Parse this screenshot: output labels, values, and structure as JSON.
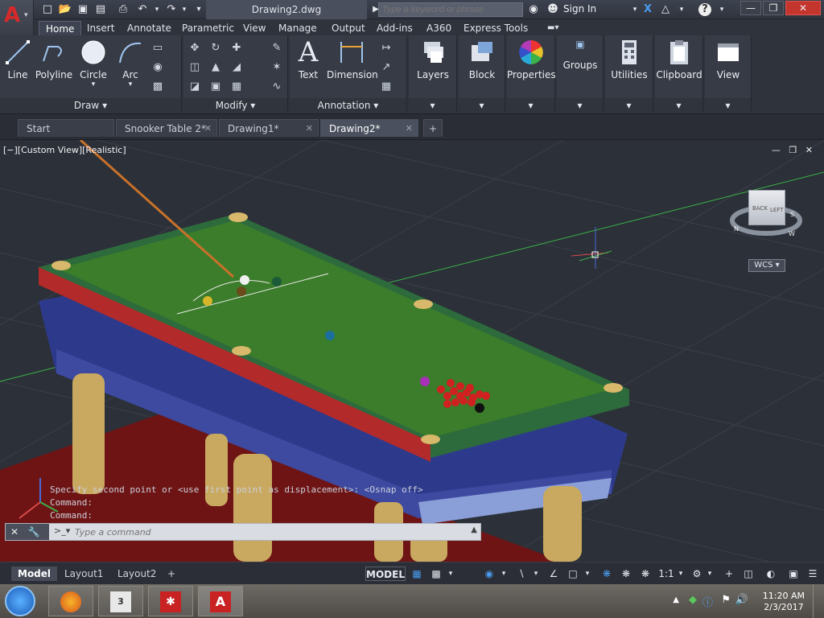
{
  "titlebar": {
    "doc_title": "Drawing2.dwg",
    "search_placeholder": "Type a keyword or phrase",
    "signin_label": "Sign In",
    "help_label": "?"
  },
  "ribbon_tabs": [
    {
      "label": "Home"
    },
    {
      "label": "Insert"
    },
    {
      "label": "Annotate"
    },
    {
      "label": "Parametric"
    },
    {
      "label": "View"
    },
    {
      "label": "Manage"
    },
    {
      "label": "Output"
    },
    {
      "label": "Add-ins"
    },
    {
      "label": "A360"
    },
    {
      "label": "Express Tools"
    }
  ],
  "ribbon": {
    "draw": {
      "title": "Draw",
      "line": "Line",
      "polyline": "Polyline",
      "circle": "Circle",
      "arc": "Arc"
    },
    "modify": {
      "title": "Modify"
    },
    "annotation": {
      "title": "Annotation",
      "text": "Text",
      "dimension": "Dimension"
    },
    "layers": "Layers",
    "block": "Block",
    "properties": "Properties",
    "groups": "Groups",
    "utilities": "Utilities",
    "clipboard": "Clipboard",
    "view": "View"
  },
  "doc_tabs": [
    {
      "label": "Start"
    },
    {
      "label": "Snooker Table 2*"
    },
    {
      "label": "Drawing1*"
    },
    {
      "label": "Drawing2*"
    }
  ],
  "viewport": {
    "label": "[−][Custom View][Realistic]",
    "viewcube_left": "LEFT",
    "viewcube_back": "BACK",
    "wcs": "WCS",
    "compass_s": "S",
    "compass_w": "W",
    "compass_n": "N"
  },
  "command": {
    "history_1": "Specify second point or <use first point as displacement>:  <Osnap off>",
    "history_2": "Command:",
    "history_3": "Command:",
    "input_placeholder": "Type a command"
  },
  "layout_tabs": [
    {
      "label": "Model"
    },
    {
      "label": "Layout1"
    },
    {
      "label": "Layout2"
    }
  ],
  "status": {
    "model": "MODEL",
    "scale": "1:1"
  },
  "taskbar": {
    "time": "11:20 AM",
    "date": "2/3/2017"
  },
  "colors": {
    "felt": "#3b7d2a",
    "rail": "#b32a2a",
    "wood": "#2d3a8c",
    "carpet": "#6e1414",
    "brass": "#c9a860"
  }
}
